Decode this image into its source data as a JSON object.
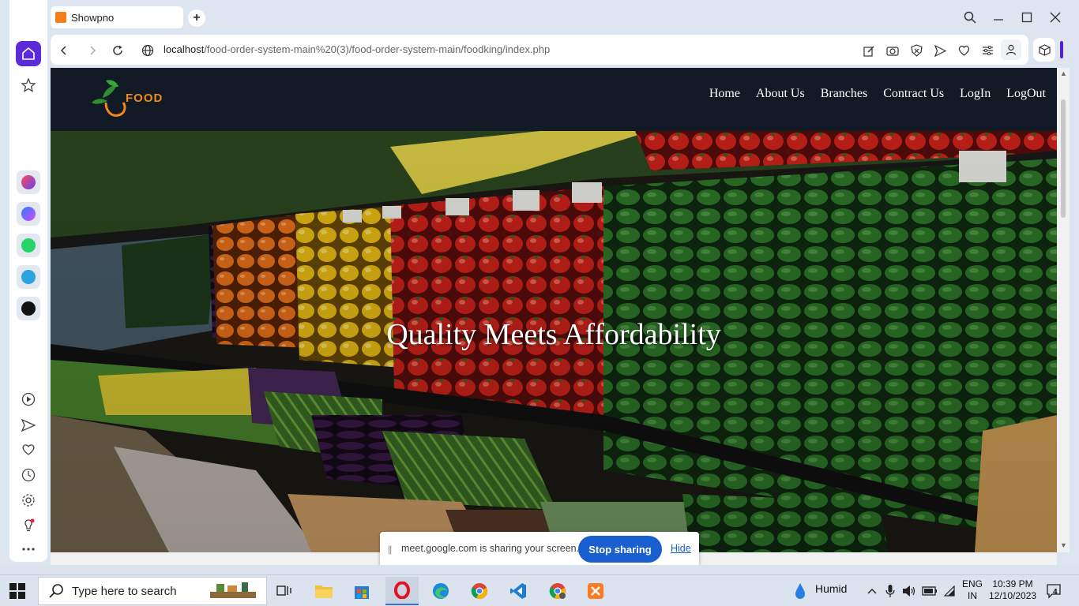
{
  "browser": {
    "tab_title": "Showpno",
    "new_tab_label": "+",
    "url_host": "localhost",
    "url_path": "/food-order-system-main%20(3)/food-order-system-main/foodking/index.php"
  },
  "site": {
    "logo_text": "FOOD",
    "nav": [
      "Home",
      "About Us",
      "Branches",
      "Contract Us",
      "LogIn",
      "LogOut"
    ],
    "hero_title": "Quality Meets Affordability"
  },
  "share_bar": {
    "message": "meet.google.com is sharing your screen.",
    "stop_label": "Stop sharing",
    "hide_label": "Hide"
  },
  "taskbar": {
    "search_placeholder": "Type here to search",
    "weather": "Humid",
    "lang_line1": "ENG",
    "lang_line2": "IN",
    "time": "10:39 PM",
    "date": "12/10/2023",
    "notification_count": "4"
  },
  "colors": {
    "navbar_bg": "#121a26",
    "logo_orange": "#f08a1c",
    "opera_red": "#ff1b2d",
    "opera_accent": "#5b2bd9",
    "share_blue": "#1a5fd0"
  }
}
